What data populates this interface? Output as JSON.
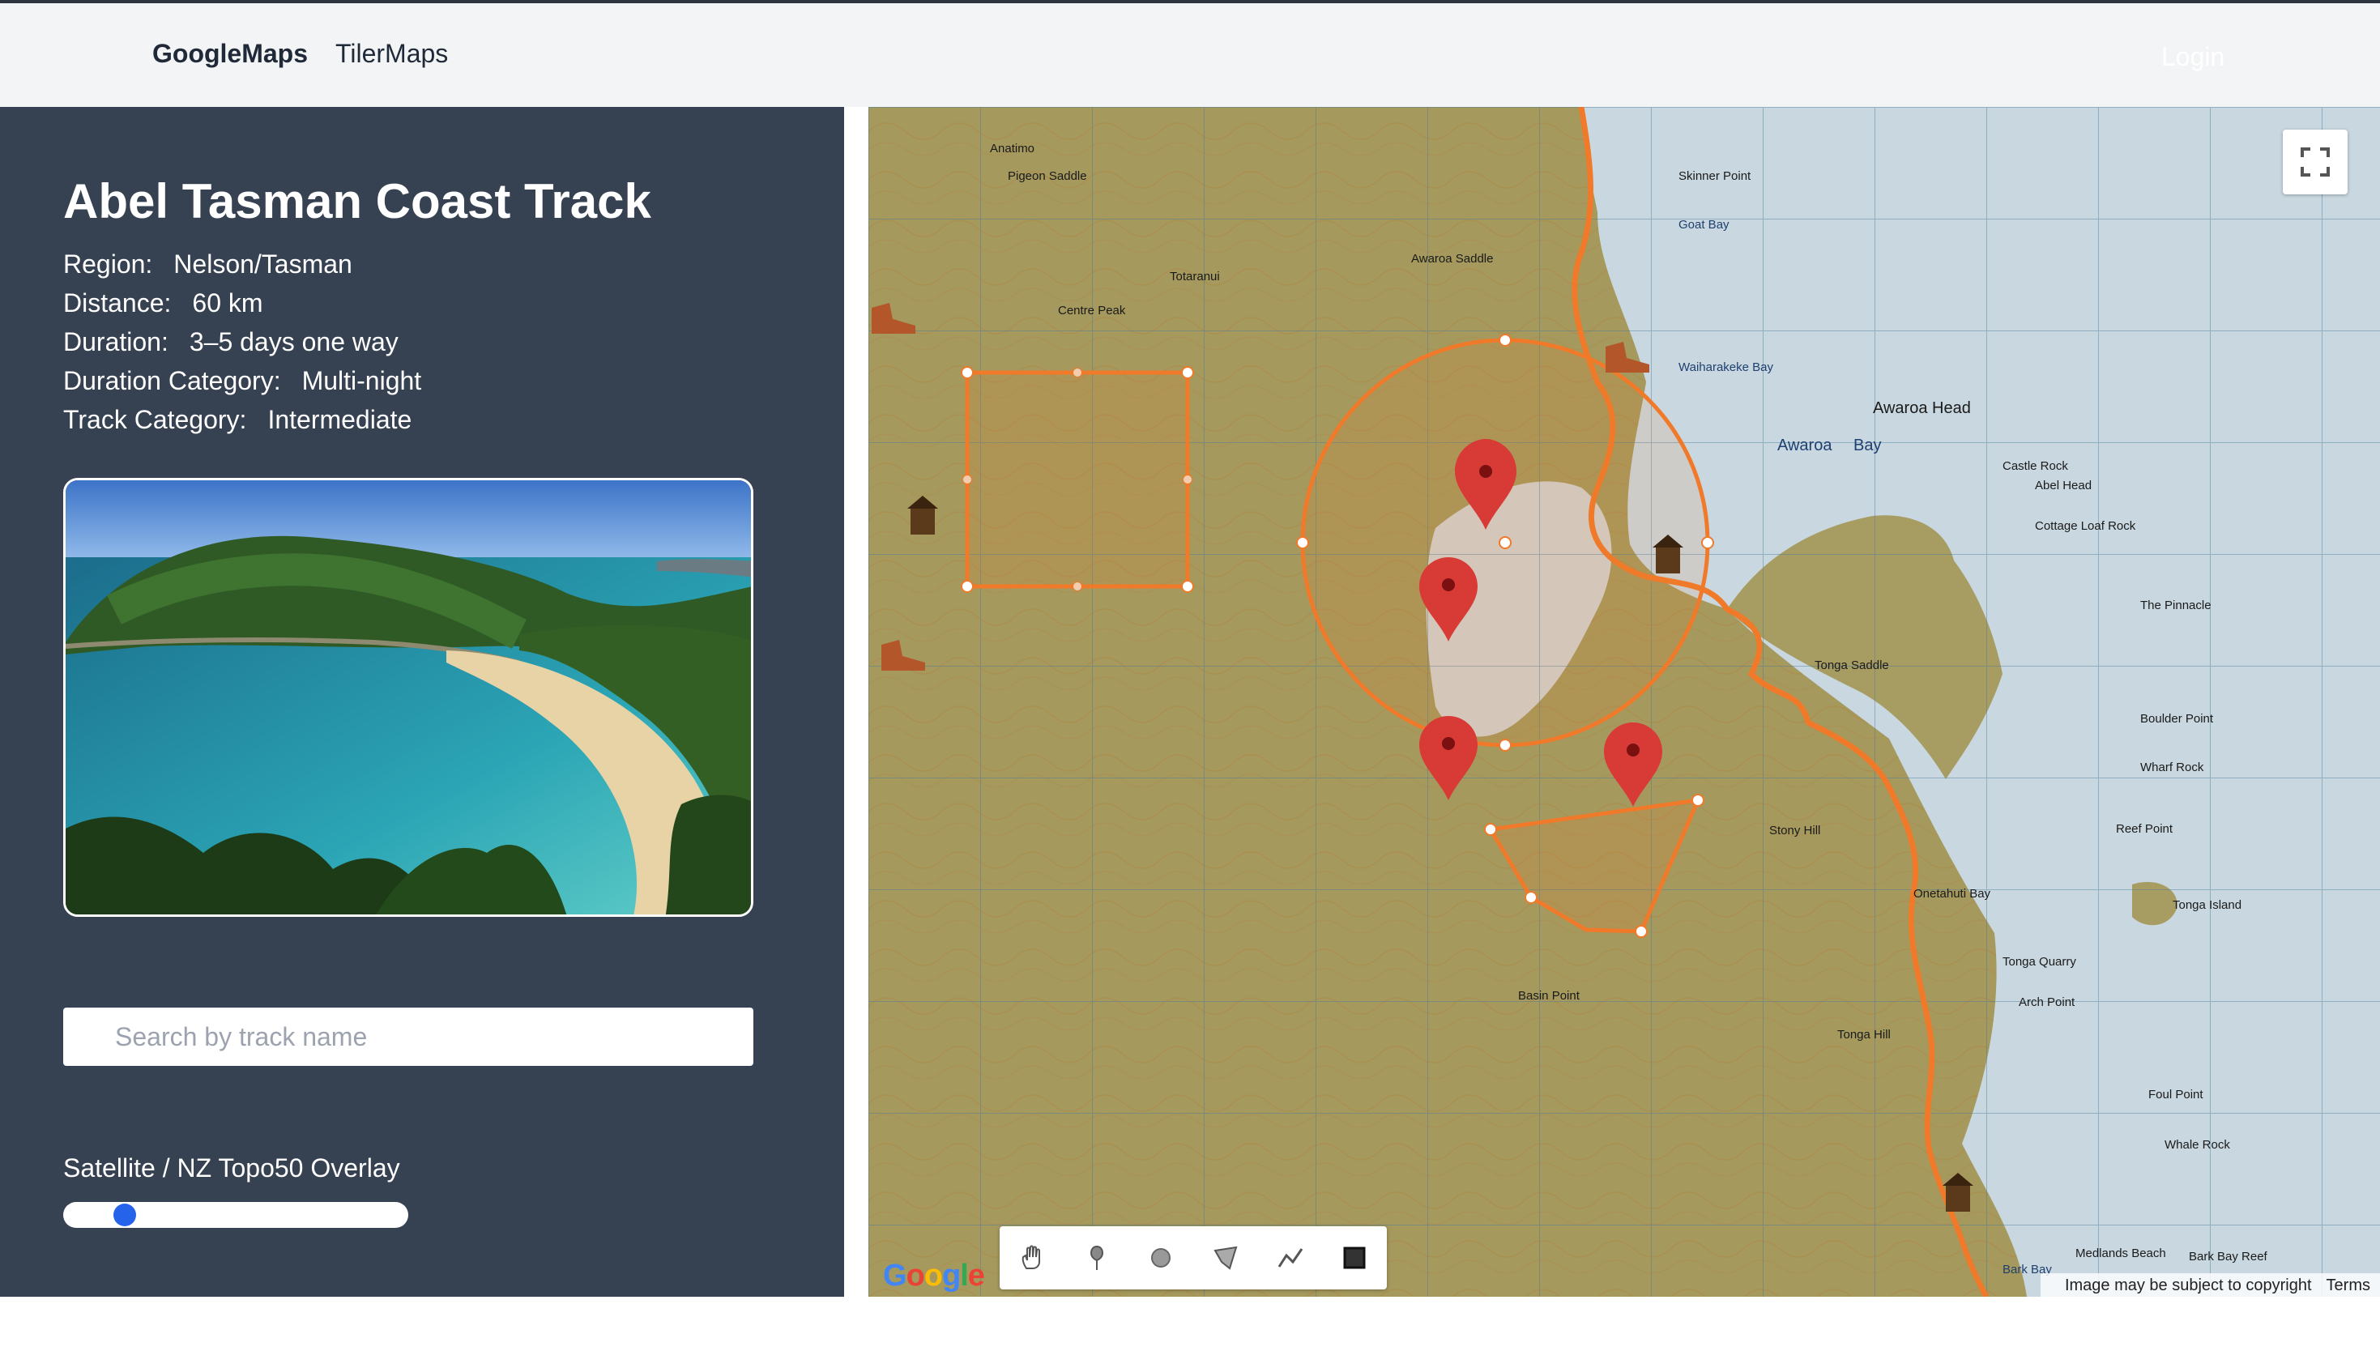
{
  "nav": {
    "brand": "GoogleMaps",
    "link": "TilerMaps",
    "login": "Login"
  },
  "track": {
    "title": "Abel Tasman Coast Track",
    "details": [
      {
        "label": "Region:",
        "value": "Nelson/Tasman"
      },
      {
        "label": "Distance:",
        "value": "60 km"
      },
      {
        "label": "Duration:",
        "value": "3–5 days one way"
      },
      {
        "label": "Duration Category:",
        "value": "Multi-night"
      },
      {
        "label": "Track Category:",
        "value": "Intermediate"
      }
    ]
  },
  "search": {
    "placeholder": "Search by track name",
    "value": ""
  },
  "overlay": {
    "label": "Satellite / NZ Topo50 Overlay",
    "value_fraction": 0.15
  },
  "map": {
    "place_labels": [
      "Awaroa Head",
      "Awaroa",
      "Bay",
      "Goat Bay",
      "Skinner Point",
      "Waiharakeke Bay",
      "Tonga Island",
      "Tonga Quarry",
      "Onetahuti Bay",
      "Bark Bay",
      "Foul Point",
      "Reef Point",
      "Stony Hill",
      "Tonga Hill",
      "Basin Point",
      "The Pinnacle",
      "Boulder Point",
      "Wharf Rock",
      "Arch Point",
      "Centre Peak",
      "Castle Rock",
      "Abel Head",
      "Cottage Loaf Rock",
      "Whale Rock",
      "Medlands Beach",
      "Bark Bay Reef",
      "Tonga Saddle",
      "Awaroa Saddle",
      "Pigeon Saddle",
      "Totaranui",
      "Anatimo"
    ],
    "google_logo": "Google",
    "copyright": "Image may be subject to copyright",
    "terms": "Terms",
    "tools": [
      "hand-icon",
      "marker-icon",
      "circle-icon",
      "polygon-icon",
      "polyline-icon",
      "rectangle-icon"
    ],
    "colors": {
      "route": "#f07a2a",
      "shape": "#f07a2a",
      "marker": "#d83a35"
    }
  }
}
